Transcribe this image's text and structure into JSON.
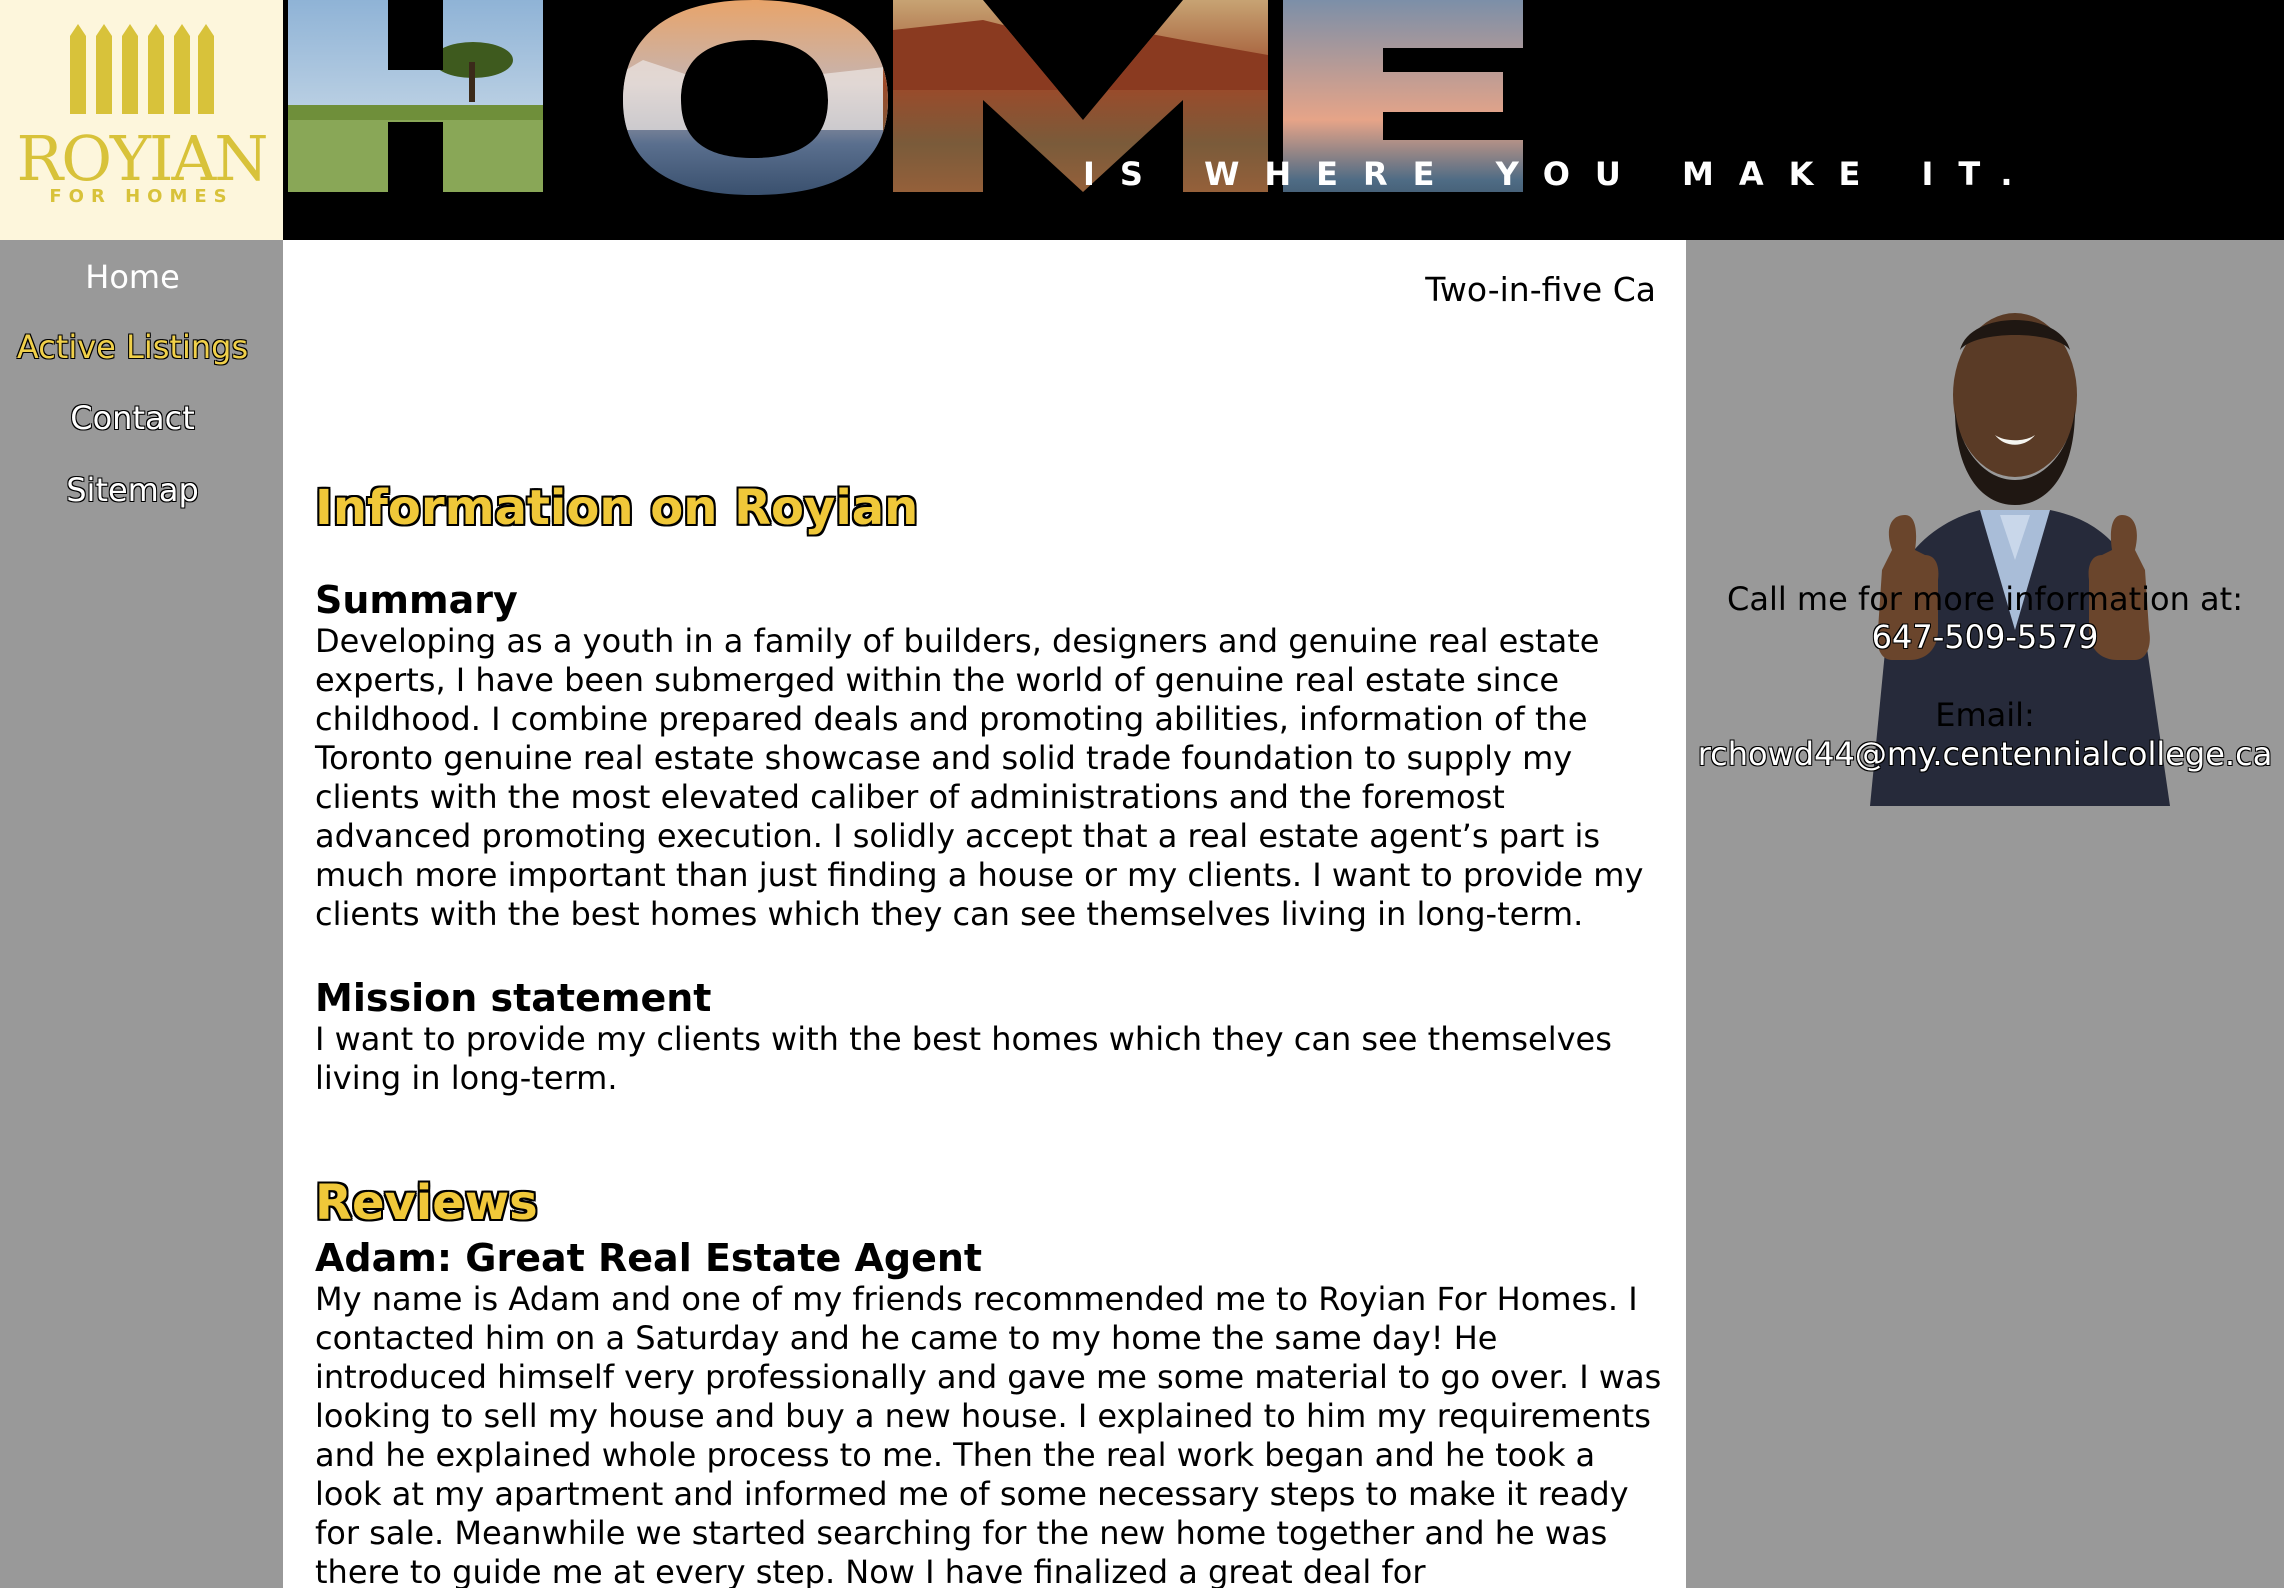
{
  "logo": {
    "word": "ROYIAN",
    "sub": "FOR HOMES",
    "icon": "building-columns-icon",
    "color": "#d8c23a"
  },
  "banner": {
    "headline": "HOME",
    "tagline": "IS WHERE YOU MAKE IT."
  },
  "nav": {
    "items": [
      {
        "label": "Home"
      },
      {
        "label": "Active Listings"
      },
      {
        "label": "Contact"
      },
      {
        "label": "Sitemap"
      }
    ],
    "active_color": "#f0d04a"
  },
  "main": {
    "marquee": "Two-in-five Ca",
    "info_title": "Information on Royian",
    "summary_heading": "Summary",
    "summary_text": "Developing as a youth in a family of builders, designers and genuine real estate experts, I have been submerged within the world of genuine real estate since childhood. I combine prepared deals and promoting abilities, information of the Toronto genuine real estate showcase and solid trade foundation to supply my clients with the most elevated caliber of administrations and the foremost advanced promoting execution. I solidly accept that a real estate agent’s part is much more important than just finding a house or my clients. I want to provide my clients with the best homes which they can see themselves living in long-term.",
    "mission_heading": "Mission statement",
    "mission_text": "I want to provide my clients with the best homes which they can see themselves living in long-term.",
    "reviews_title": "Reviews",
    "review_heading": "Adam: Great Real Estate Agent",
    "review_text": "My name is Adam and one of my friends recommended me to Royian For Homes. I contacted him on a Saturday and he came to my home the same day! He introduced himself very professionally and gave me some material to go over. I was looking to sell my house and buy a new house. I explained to him my requirements and he explained whole process to me. Then the real work began and he took a look at my apartment and informed me of some necessary steps to make it ready for sale. Meanwhile we started searching for the new home together and he was there to guide me at every step. Now I have finalized a great deal for"
  },
  "sidebar": {
    "call_text": "Call me for more information at:",
    "phone": "647-509-5579",
    "email_label": "Email:",
    "email": "rchowd44@my.centennialcollege.ca"
  },
  "colors": {
    "page_bg": "#999999",
    "content_bg": "#ffffff",
    "heading_yellow": "#f0c839",
    "logo_bg": "#fdf6dc"
  }
}
